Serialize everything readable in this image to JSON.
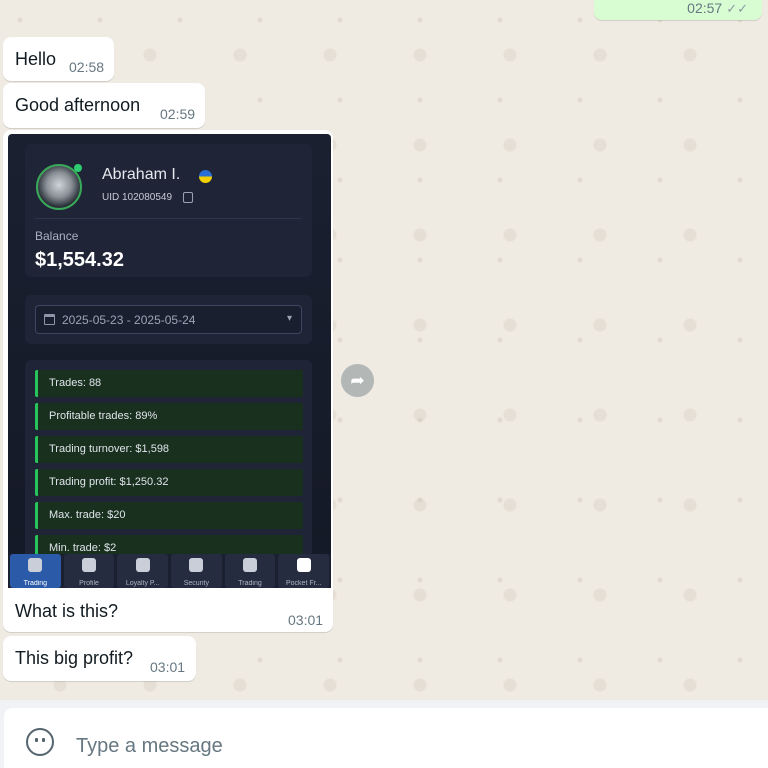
{
  "messages": {
    "top_partial": {
      "time": "02:57",
      "ticks": "✓✓"
    },
    "hello": {
      "text": "Hello",
      "time": "02:58"
    },
    "good_afternoon": {
      "text": "Good afternoon",
      "time": "02:59"
    },
    "what_is_this": {
      "text": "What is this?",
      "time": "03:01"
    },
    "big_profit": {
      "text": "This big profit?",
      "time": "03:01"
    }
  },
  "screenshot": {
    "profile": {
      "name": "Abraham I.",
      "uid": "UID 102080549",
      "balance_label": "Balance",
      "balance_value": "$1,554.32"
    },
    "date_range": "2025-05-23 - 2025-05-24",
    "stats": [
      "Trades: 88",
      "Profitable trades: 89%",
      "Trading turnover: $1,598",
      "Trading profit: $1,250.32",
      "Max. trade: $20",
      "Min. trade: $2"
    ],
    "nav": [
      "Trading",
      "Profile",
      "Loyalty P...",
      "Security",
      "Trading",
      "Pocket Fr..."
    ]
  },
  "composer": {
    "placeholder": "Type a message"
  },
  "icons": {
    "forward": "forward-icon",
    "sticker": "sticker-icon",
    "calendar": "calendar-icon",
    "copy": "copy-icon"
  },
  "colors": {
    "chat_bg": "#efeae2",
    "incoming_bubble": "#ffffff",
    "outgoing_bubble": "#d9fdd3",
    "stat_accent": "#27c35d"
  }
}
